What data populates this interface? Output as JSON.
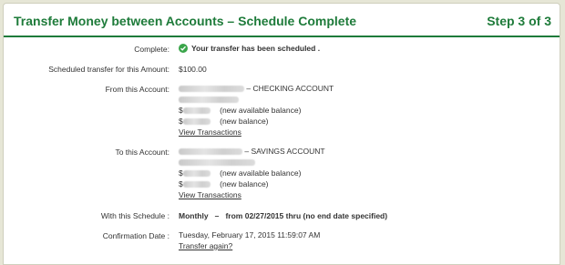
{
  "header": {
    "title": "Transfer Money between Accounts – Schedule Complete",
    "step": "Step 3 of 3"
  },
  "rows": {
    "complete": {
      "label": "Complete:",
      "message": "Your transfer has been scheduled ."
    },
    "amount": {
      "label": "Scheduled transfer for this Amount:",
      "value": "$100.00"
    },
    "from": {
      "label": "From this Account:",
      "account_suffix": "– CHECKING ACCOUNT",
      "balance_currency": "$",
      "available_text": "(new available balance)",
      "new_balance_text": "(new balance)",
      "link": "View Transactions"
    },
    "to": {
      "label": "To this Account:",
      "account_suffix": "– SAVINGS ACCOUNT",
      "balance_currency": "$",
      "available_text": "(new available balance)",
      "new_balance_text": "(new balance)",
      "link": "View Transactions"
    },
    "schedule": {
      "label": "With this Schedule :",
      "value": "Monthly   –   from 02/27/2015 thru (no end date specified)"
    },
    "confirmation": {
      "label": "Confirmation Date :",
      "value": "Tuesday, February 17, 2015 11:59:07 AM",
      "link": "Transfer again?"
    }
  },
  "colors": {
    "brand_green": "#1e7b3a",
    "check_green": "#3aa54a",
    "background": "#e6e6d6"
  },
  "icons": {
    "complete": "check-circle-icon"
  }
}
